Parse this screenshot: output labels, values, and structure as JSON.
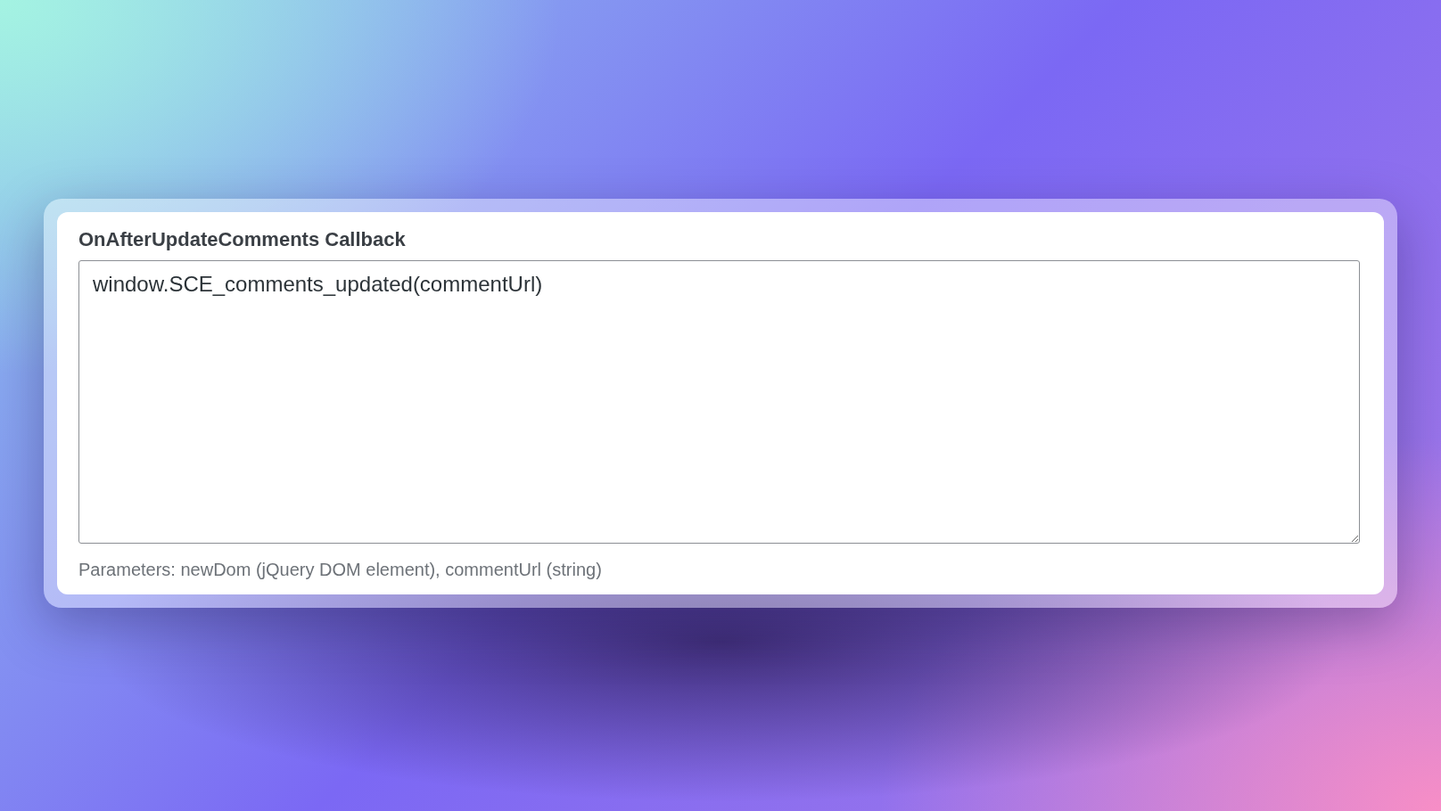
{
  "field": {
    "label": "OnAfterUpdateComments Callback",
    "value": "window.SCE_comments_updated(commentUrl)",
    "help": "Parameters: newDom (jQuery DOM element), commentUrl (string)"
  }
}
